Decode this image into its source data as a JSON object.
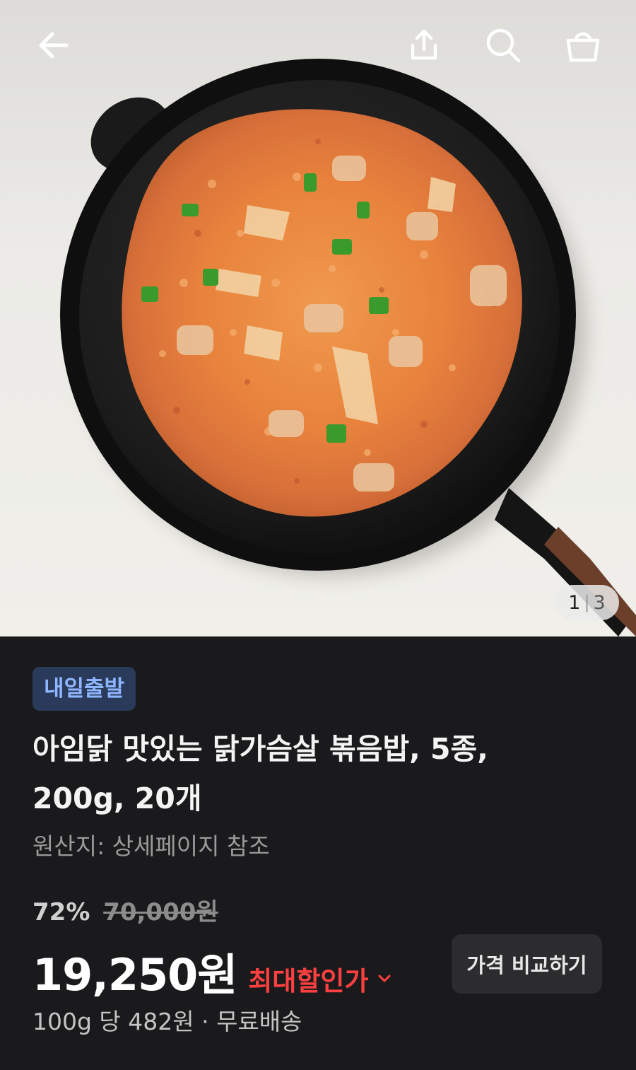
{
  "header": {
    "icons": [
      "back-arrow-icon",
      "share-icon",
      "search-icon",
      "shopping-bag-icon"
    ]
  },
  "gallery": {
    "current": "1",
    "separator": "|",
    "total": "3"
  },
  "product": {
    "badge": "내일출발",
    "title_line1": "아임닭 맛있는 닭가슴살 볶음밥, 5종,",
    "title_line2": "200g, 20개",
    "origin": "원산지: 상세페이지 참조",
    "discount_percent": "72%",
    "original_price": "70,000원",
    "price": "19,250원",
    "max_discount_label": "최대할인가",
    "compare_button": "가격 비교하기",
    "unit_price": "100g 당 482원 · 무료배송"
  },
  "colors": {
    "background": "#1a1a1c",
    "badge_bg": "#2a3a5a",
    "badge_text": "#8eb6ff",
    "accent_red": "#ff4040"
  }
}
